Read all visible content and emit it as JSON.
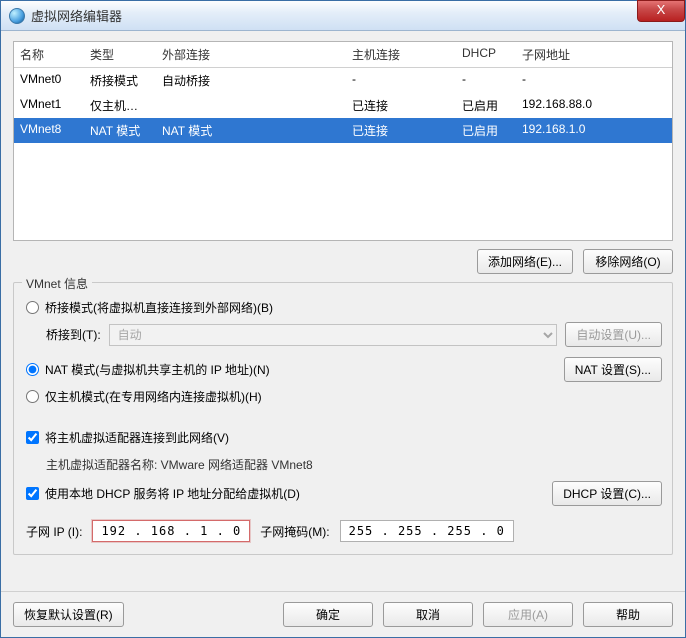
{
  "window": {
    "title": "虚拟网络编辑器",
    "close": "X"
  },
  "table": {
    "headers": {
      "name": "名称",
      "type": "类型",
      "ext": "外部连接",
      "host": "主机连接",
      "dhcp": "DHCP",
      "subnet": "子网地址"
    },
    "rows": [
      {
        "name": "VMnet0",
        "type": "桥接模式",
        "ext": "自动桥接",
        "host": "-",
        "dhcp": "-",
        "subnet": "-"
      },
      {
        "name": "VMnet1",
        "type": "仅主机…",
        "ext": "",
        "host": "已连接",
        "dhcp": "已启用",
        "subnet": "192.168.88.0"
      },
      {
        "name": "VMnet8",
        "type": "NAT 模式",
        "ext": "NAT 模式",
        "host": "已连接",
        "dhcp": "已启用",
        "subnet": "192.168.1.0"
      }
    ]
  },
  "buttons": {
    "add": "添加网络(E)...",
    "remove": "移除网络(O)"
  },
  "group": {
    "title": "VMnet 信息",
    "bridge_radio": "桥接模式(将虚拟机直接连接到外部网络)(B)",
    "bridge_to": "桥接到(T):",
    "bridge_select": "自动",
    "bridge_auto_btn": "自动设置(U)...",
    "nat_radio": "NAT 模式(与虚拟机共享主机的 IP 地址)(N)",
    "nat_btn": "NAT 设置(S)...",
    "hostonly_radio": "仅主机模式(在专用网络内连接虚拟机)(H)",
    "host_adapter_check": "将主机虚拟适配器连接到此网络(V)",
    "host_adapter_label": "主机虚拟适配器名称: VMware 网络适配器 VMnet8",
    "dhcp_check": "使用本地 DHCP 服务将 IP 地址分配给虚拟机(D)",
    "dhcp_btn": "DHCP 设置(C)...",
    "subnet_ip_label": "子网 IP (I):",
    "subnet_ip": "192 . 168 .  1  .  0",
    "subnet_mask_label": "子网掩码(M):",
    "subnet_mask": "255 . 255 . 255 .  0"
  },
  "bottom": {
    "restore": "恢复默认设置(R)",
    "ok": "确定",
    "cancel": "取消",
    "apply": "应用(A)",
    "help": "帮助"
  }
}
